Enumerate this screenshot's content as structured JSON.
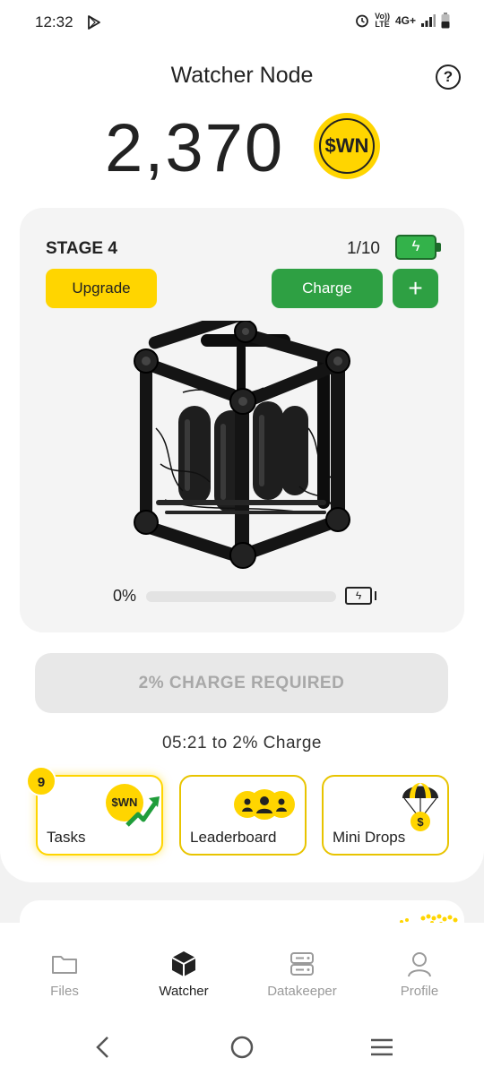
{
  "status_bar": {
    "time": "12:32",
    "volte_top": "Vo))",
    "volte_bottom": "LTE",
    "network": "4G+"
  },
  "header": {
    "title": "Watcher Node",
    "help_symbol": "?",
    "balance": "2,370",
    "coin_label": "$WN"
  },
  "stage": {
    "label": "STAGE 4",
    "count": "1/10",
    "upgrade_label": "Upgrade",
    "charge_label": "Charge",
    "plus_symbol": "+",
    "progress_text": "0%",
    "progress_value": 0,
    "battery_symbol": "ϟ"
  },
  "charge_required": {
    "label": "2% CHARGE REQUIRED",
    "timer": "05:21 to 2% Charge"
  },
  "actions": [
    {
      "label": "Tasks",
      "badge": "9",
      "coin": "$WN"
    },
    {
      "label": "Leaderboard"
    },
    {
      "label": "Mini Drops"
    }
  ],
  "nav": [
    {
      "label": "Files",
      "icon": "folder-icon"
    },
    {
      "label": "Watcher",
      "icon": "cube-icon",
      "active": true
    },
    {
      "label": "Datakeeper",
      "icon": "server-icon"
    },
    {
      "label": "Profile",
      "icon": "user-icon"
    }
  ],
  "colors": {
    "accent_yellow": "#ffd500",
    "accent_green": "#2ea043",
    "text_dark": "#222222",
    "disabled_text": "#a8a8a8"
  }
}
